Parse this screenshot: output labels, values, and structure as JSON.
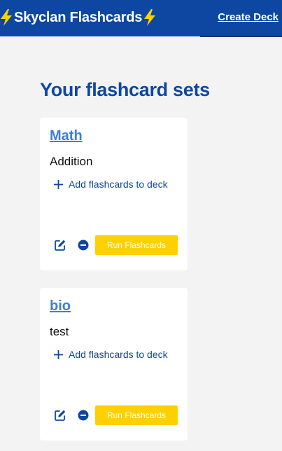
{
  "header": {
    "brand_title": "Skyclan Flashcards",
    "create_deck_label": "Create Deck",
    "background_color": "#0d47a1",
    "bolt_color": "#ffd000"
  },
  "main": {
    "page_title": "Your flashcard sets"
  },
  "decks": [
    {
      "title": "Math",
      "description": "Addition",
      "add_label": "Add flashcards to deck",
      "run_label": "Run Flashcards"
    },
    {
      "title": "bio",
      "description": "test",
      "add_label": "Add flashcards to deck",
      "run_label": "Run Flashcards"
    }
  ],
  "icons": {
    "brand_left": "lightning-bolt-icon",
    "brand_right": "lightning-bolt-icon",
    "add": "plus-icon",
    "edit": "edit-icon",
    "remove": "minus-circle-icon"
  },
  "colors": {
    "accent": "#0d47a1",
    "link": "#3b7fd6",
    "run_button": "#ffd000",
    "page_background": "#f3f3f3"
  }
}
